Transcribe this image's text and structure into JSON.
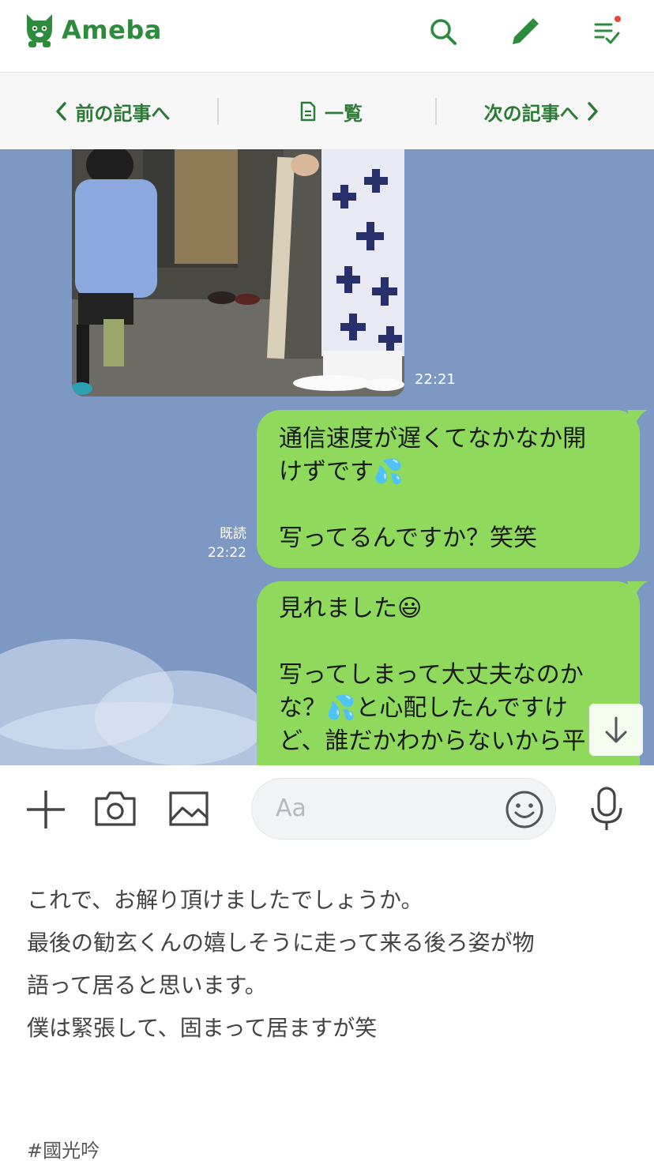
{
  "header": {
    "logo_text": "Ameba",
    "search_icon": "search-icon",
    "edit_icon": "pencil-icon",
    "feed_icon": "list-check-icon",
    "brand_color": "#2d8c3c",
    "notification_dot_color": "#e8473a"
  },
  "article_nav": {
    "prev_label": "前の記事へ",
    "list_label": "一覧",
    "next_label": "次の記事へ"
  },
  "chat": {
    "photo_time": "22:21",
    "read_label": "既読",
    "read_time": "22:22",
    "bubble1_lines": [
      "通信速度が遅くてなかなか開",
      "けずです💦",
      "",
      "写ってるんですか？笑笑"
    ],
    "bubble2_lines": [
      "見れました😃",
      "",
      "写ってしまって大丈夫なのか",
      "な？💦と心配したんですけ",
      "ど、誰だかわからないから平"
    ],
    "background_color": "#7e98c4",
    "bubble_color": "#8fd95c"
  },
  "input_bar": {
    "placeholder": "Aa"
  },
  "article": {
    "lines": [
      "これで、お解り頂けましたでしょうか。",
      "最後の勧玄くんの嬉しそうに走って来る後ろ姿が物",
      "語って居ると思います。",
      "僕は緊張して、固まって居ますが笑"
    ],
    "hashtag": "#國光吟"
  }
}
